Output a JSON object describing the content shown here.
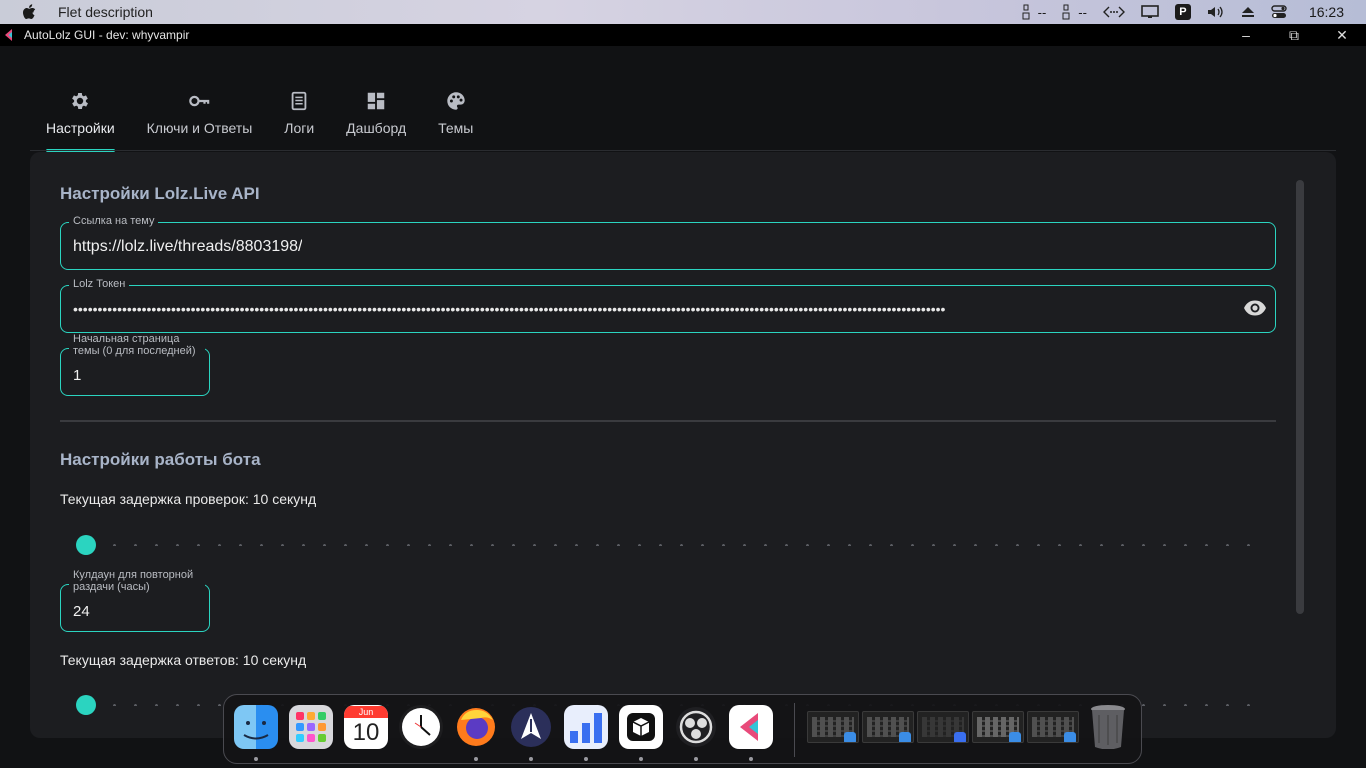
{
  "menubar": {
    "app_name": "Flet description",
    "status_items": [
      "--",
      "--"
    ],
    "clock": "16:23",
    "p_badge": "P"
  },
  "window": {
    "title": "AutoLolz GUI - dev: whyvampir",
    "minimize": "–",
    "maximize": "⧉",
    "close": "✕"
  },
  "tabs": [
    {
      "label": "Настройки",
      "icon": "gear-icon",
      "active": true
    },
    {
      "label": "Ключи и Ответы",
      "icon": "key-icon",
      "active": false
    },
    {
      "label": "Логи",
      "icon": "document-icon",
      "active": false
    },
    {
      "label": "Дашборд",
      "icon": "dashboard-icon",
      "active": false
    },
    {
      "label": "Темы",
      "icon": "palette-icon",
      "active": false
    }
  ],
  "api_section": {
    "title": "Настройки Lolz.Live API",
    "thread_link": {
      "label": "Ссылка на тему",
      "value": "https://lolz.live/threads/8803198/"
    },
    "token": {
      "label": "Lolz Токен",
      "masked_value": "••••••••••••••••••••••••••••••••••••••••••••••••••••••••••••••••••••••••••••••••••••••••••••••••••••••••••••••••••••••••••••••••••••••••••••••••••••••••••••••••••••••••••••••••••"
    },
    "start_page": {
      "label": "Начальная страница темы (0 для последней)",
      "value": "1"
    }
  },
  "bot_section": {
    "title": "Настройки работы бота",
    "check_delay_text": "Текущая задержка проверок: 10 секунд",
    "check_delay_slider": {
      "value": 10
    },
    "cooldown": {
      "label": "Кулдаун для повторной раздачи (часы)",
      "value": "24"
    },
    "reply_delay_text": "Текущая задержка ответов: 10 секунд",
    "reply_delay_slider": {
      "value": 10
    }
  },
  "dock": {
    "apps": [
      "finder-icon",
      "launchpad-icon",
      "calendar-icon",
      "clock-icon",
      "firefox-icon",
      "app-a-icon",
      "chart-app-icon",
      "box-app-icon",
      "obs-icon",
      "flet-icon"
    ],
    "calendar": {
      "month": "Jun",
      "day": "10"
    }
  },
  "colors": {
    "accent": "#2bd4c0",
    "panel": "#1c1d20",
    "background": "#111214",
    "section_title": "#a8b4c8"
  }
}
